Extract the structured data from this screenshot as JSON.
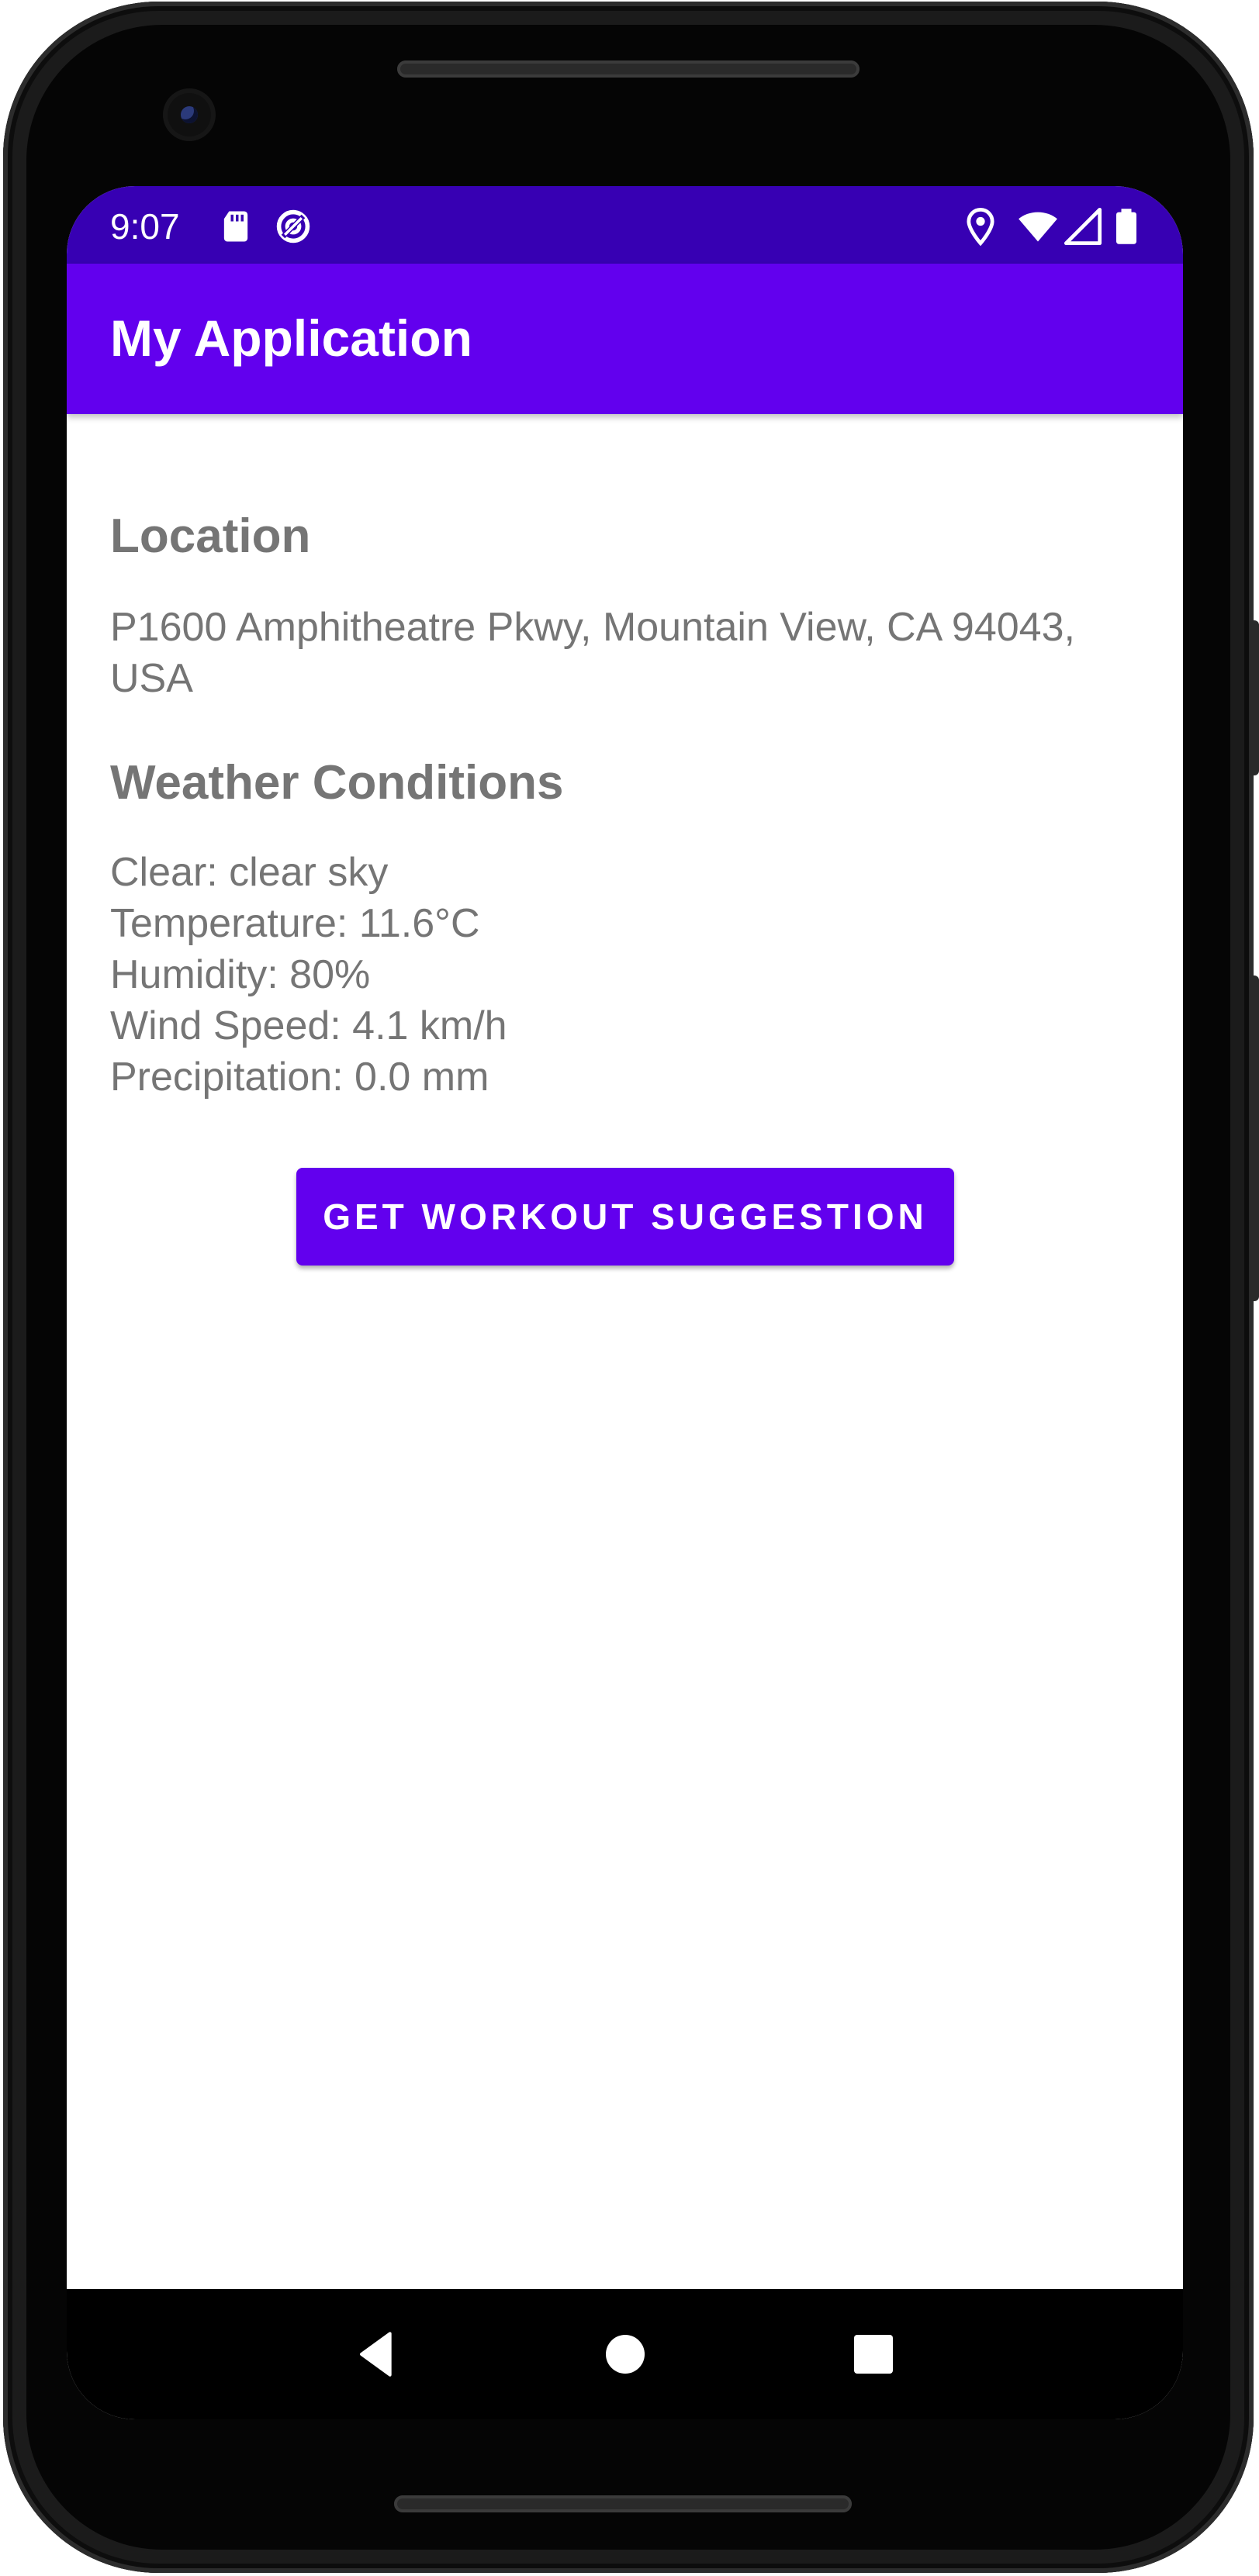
{
  "status_bar": {
    "time": "9:07",
    "left_icons": [
      "sd-card-icon",
      "sync-icon"
    ],
    "right_icons": [
      "location-icon",
      "wifi-icon",
      "cell-signal-icon",
      "battery-icon"
    ]
  },
  "app_bar": {
    "title": "My Application"
  },
  "location": {
    "heading": "Location",
    "address": "P1600 Amphitheatre Pkwy, Mountain View, CA 94043, USA"
  },
  "weather": {
    "heading": "Weather Conditions",
    "lines": [
      "Clear: clear sky",
      "Temperature: 11.6°C",
      "Humidity: 80%",
      "Wind Speed: 4.1 km/h",
      "Precipitation: 0.0 mm"
    ]
  },
  "action": {
    "label": "GET WORKOUT SUGGESTION"
  },
  "nav_bar": {
    "buttons": [
      "back-icon",
      "home-icon",
      "recents-icon"
    ]
  },
  "colors": {
    "primary": "#6200ee",
    "primary_dark": "#3700b3",
    "text_secondary": "#757575"
  }
}
